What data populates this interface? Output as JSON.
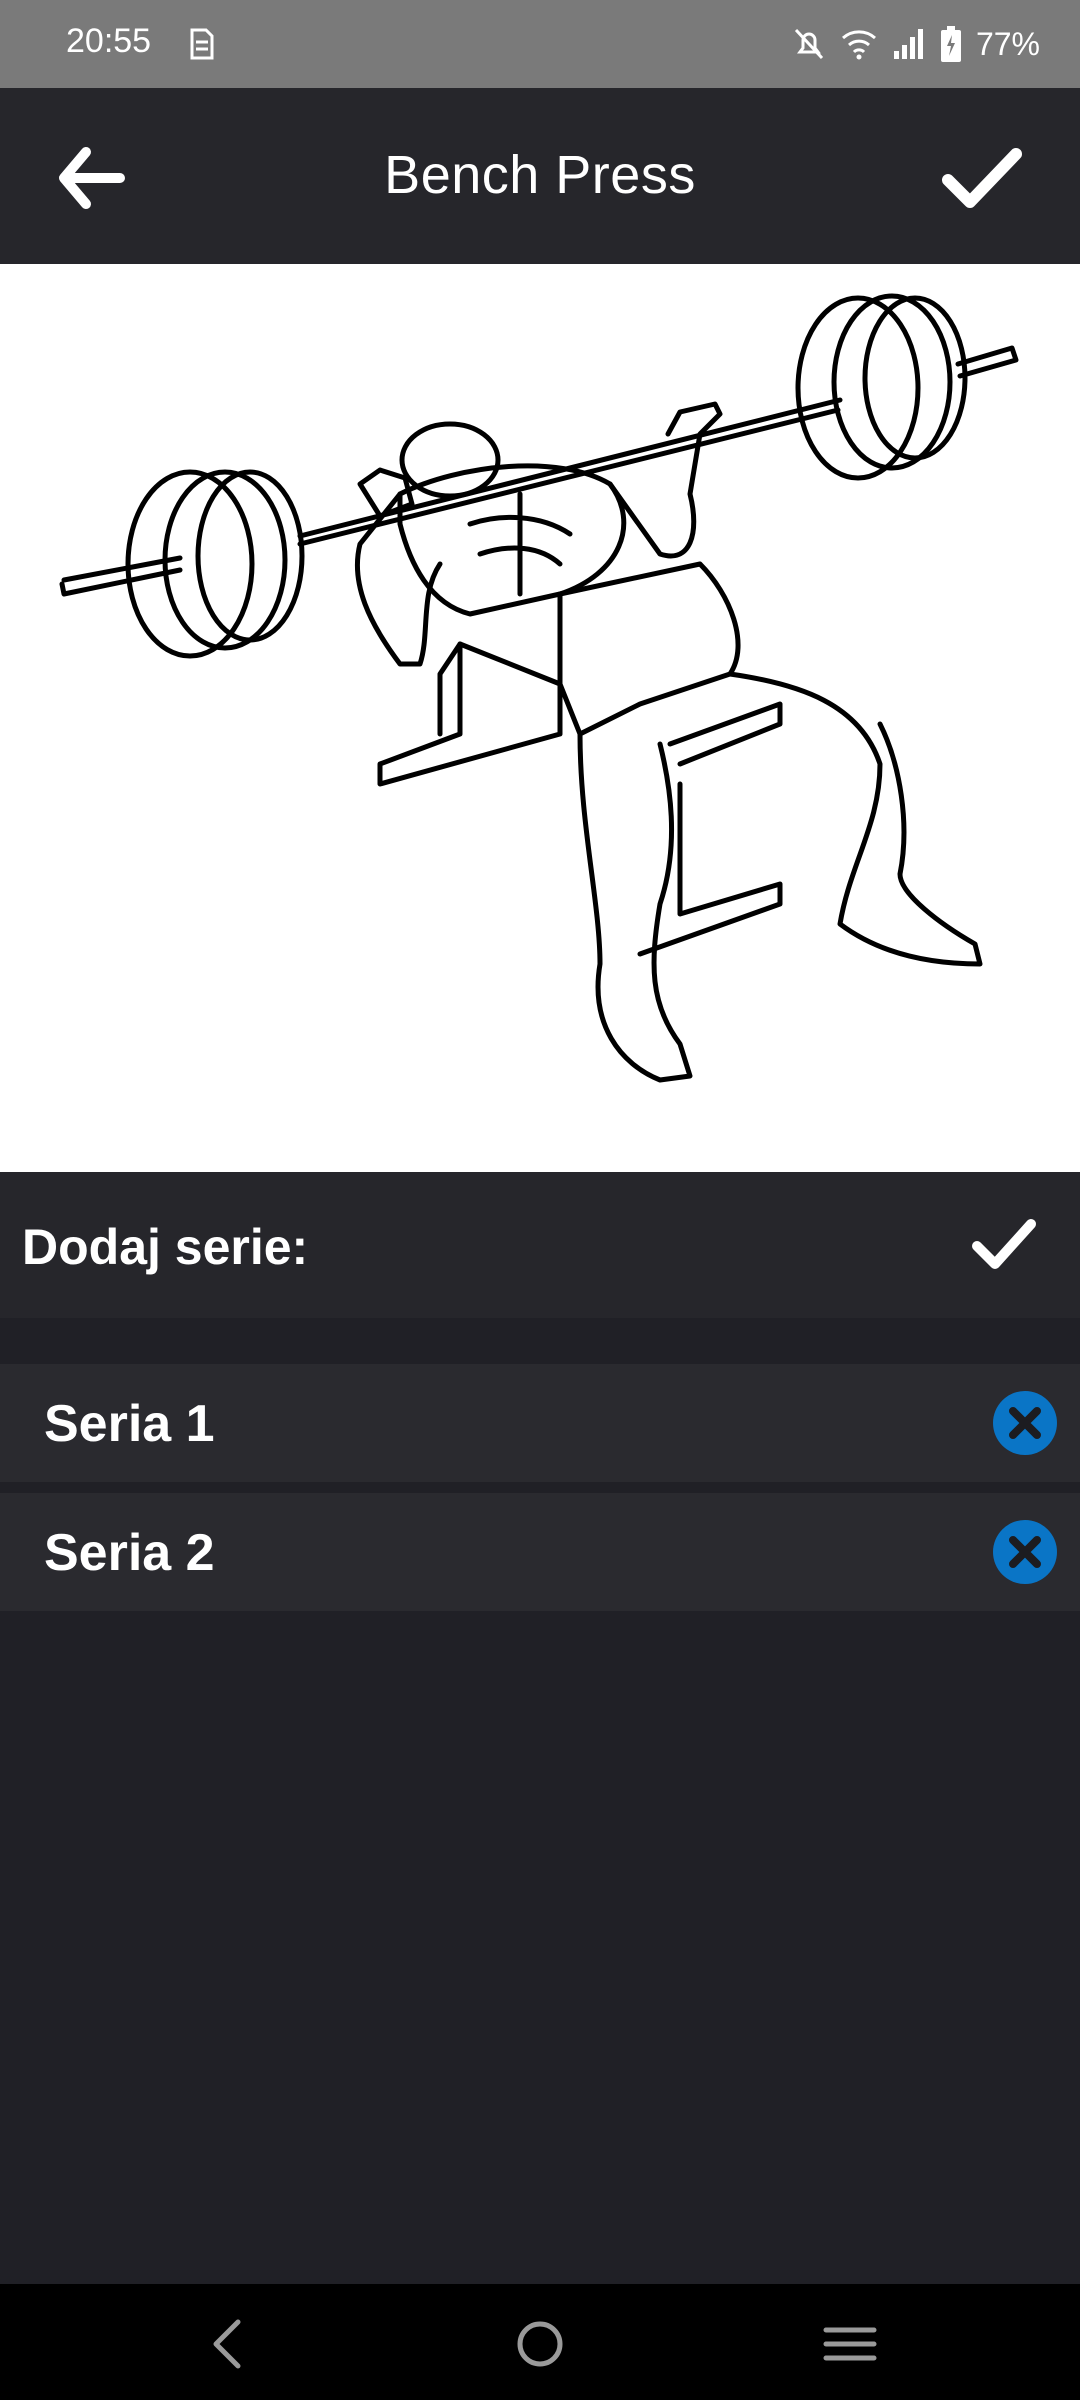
{
  "status": {
    "time": "20:55",
    "battery": "77%"
  },
  "header": {
    "title": "Bench Press"
  },
  "add_series": {
    "label": "Dodaj serie:"
  },
  "series": [
    {
      "label": "Seria 1"
    },
    {
      "label": "Seria 2"
    }
  ],
  "colors": {
    "app_bar": "#26262b",
    "background": "#202026",
    "accent_remove": "#0a75c6"
  },
  "icons": [
    "back-arrow-icon",
    "check-icon",
    "remove-icon",
    "nav-back-icon",
    "nav-home-icon",
    "nav-menu-icon"
  ]
}
